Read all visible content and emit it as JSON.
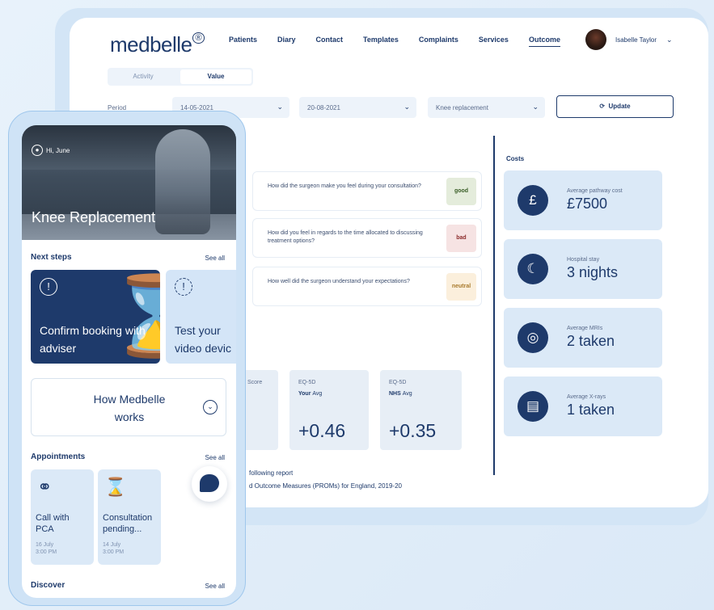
{
  "desktop": {
    "logo": "medbelle",
    "logo_mark": "®",
    "nav": [
      "Patients",
      "Diary",
      "Contact",
      "Templates",
      "Complaints",
      "Services",
      "Outcome"
    ],
    "nav_active": "Outcome",
    "user_name": "Isabelle Taylor",
    "tabs": [
      "Activity",
      "Value"
    ],
    "active_tab": "Value",
    "period_label": "Period",
    "from_date": "14-05-2021",
    "to_date": "20-08-2021",
    "procedure": "Knee replacement",
    "update_label": "Update",
    "costs_title": "Costs",
    "costs": [
      {
        "icon": "pound-icon",
        "label": "Average pathway cost",
        "value": "£7500"
      },
      {
        "icon": "hospital-stay-icon",
        "label": "Hospital stay",
        "value": "3 nights"
      },
      {
        "icon": "mri-icon",
        "label": "Average MRIs",
        "value": "2 taken"
      },
      {
        "icon": "xray-icon",
        "label": "Average X-rays",
        "value": "1 taken"
      }
    ],
    "questions": [
      {
        "text": "How did the surgeon make you feel during your consultation?",
        "rating": "good"
      },
      {
        "text": "How did you feel in regards to the time allocated to discussing treatment options?",
        "rating": "bad"
      },
      {
        "text": "How well did the surgeon understand your expectations?",
        "rating": "neutral"
      }
    ],
    "score_label": "Score",
    "eq_cards": [
      {
        "label": "EQ-5D",
        "sub_bold": "Your",
        "sub": "Avg",
        "value": "+0.46"
      },
      {
        "label": "EQ-5D",
        "sub_bold": "NHS",
        "sub": "Avg",
        "value": "+0.35"
      }
    ],
    "footer_line1": "following report",
    "footer_line2": "d Outcome Measures (PROMs) for England, 2019-20"
  },
  "phone": {
    "greeting": "Hi, June",
    "hero_title": "Knee Replacement",
    "next_steps_title": "Next steps",
    "see_all": "See all",
    "steps": [
      {
        "text": "Confirm booking with adviser"
      },
      {
        "text": "Test your video devic"
      }
    ],
    "how_text": "How Medbelle works",
    "appointments_title": "Appointments",
    "appointments": [
      {
        "icon": "headset-icon",
        "title": "Call with PCA",
        "date": "16 July",
        "time": "3:00 PM"
      },
      {
        "icon": "hourglass-icon",
        "title": "Consultation pending...",
        "date": "14 July",
        "time": "3:00 PM"
      }
    ],
    "discover_title": "Discover"
  },
  "colors": {
    "brand": "#1e3a6b",
    "card_light": "#dbe9f7",
    "background": "#e3eef9"
  }
}
